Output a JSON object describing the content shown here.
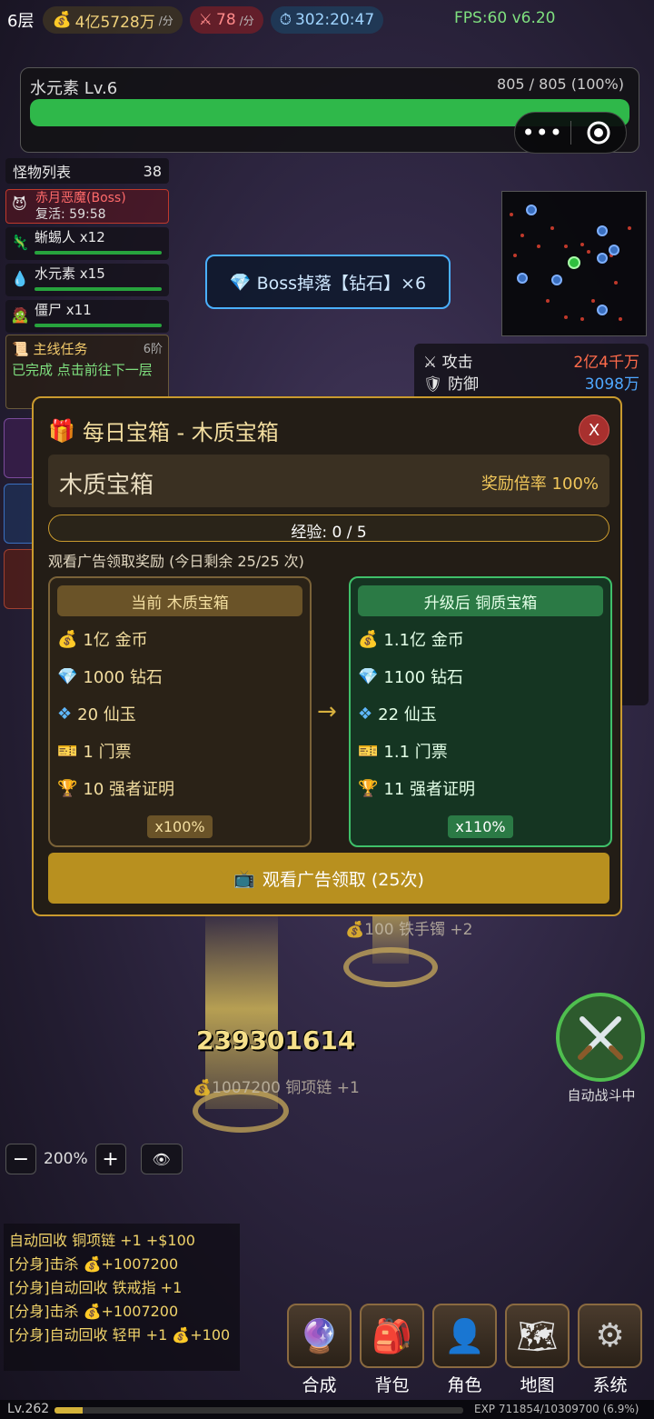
{
  "topbar": {
    "floor": "6层",
    "gold": "4亿5728万",
    "gold_unit": "/分",
    "attack": "78",
    "attack_unit": "/分",
    "time": "302:20:47",
    "fps": "FPS:60 v6.20"
  },
  "boss_hp": {
    "name": "水元素 Lv.6",
    "value": "805 / 805",
    "percent_text": "(100%)",
    "fraction": 1.0
  },
  "monster_list": {
    "title": "怪物列表",
    "count": "38",
    "boss": {
      "name": "赤月恶魔(Boss)",
      "respawn": "复活: 59:58"
    },
    "items": [
      {
        "label": "蜥蜴人 x12"
      },
      {
        "label": "水元素 x15"
      },
      {
        "label": "僵尸 x11"
      }
    ]
  },
  "quest": {
    "title": "主线任务",
    "tier": "6阶",
    "text": "已完成 点击前往下一层"
  },
  "drop_banner": {
    "text": "Boss掉落【钻石】×6"
  },
  "stats": [
    {
      "label": "攻击",
      "value": "2亿4千万",
      "color": "#ff6b4a"
    },
    {
      "label": "防御",
      "value": "3098万",
      "color": "#4fa8ff"
    }
  ],
  "modal": {
    "title": "每日宝箱 - 木质宝箱",
    "close_label": "X",
    "chest_name": "木质宝箱",
    "reward_rate": "奖励倍率 100%",
    "exp_text": "经验: 0 / 5",
    "exp_fraction": 0.0,
    "hint": "观看广告领取奖励 (今日剩余 25/25 次)",
    "arrow": "→",
    "current": {
      "header": "当前 木质宝箱",
      "rewards": [
        {
          "icon": "money-bag-icon",
          "text": "1亿 金币"
        },
        {
          "icon": "diamond-icon",
          "text": "1000 钻石"
        },
        {
          "icon": "jade-icon",
          "text": "20 仙玉"
        },
        {
          "icon": "ticket-icon",
          "text": "1 门票"
        },
        {
          "icon": "trophy-icon",
          "text": "10 强者证明"
        }
      ],
      "multiplier": "x100%"
    },
    "upgrade": {
      "header": "升级后 铜质宝箱",
      "rewards": [
        {
          "icon": "money-bag-icon",
          "text": "1.1亿 金币"
        },
        {
          "icon": "diamond-icon",
          "text": "1100 钻石"
        },
        {
          "icon": "jade-icon",
          "text": "22 仙玉"
        },
        {
          "icon": "ticket-icon",
          "text": "1.1 门票"
        },
        {
          "icon": "trophy-icon",
          "text": "11 强者证明"
        }
      ],
      "multiplier": "x110%"
    },
    "watch_button": "观看广告领取 (25次)"
  },
  "battlefield": {
    "damage_number": "239301614",
    "drop1": "1007200",
    "drop1_item": "铜项链 +1",
    "drop2": "100",
    "drop2_item": "铁手镯 +2"
  },
  "auto_fight": {
    "label": "自动战斗中"
  },
  "zoom": {
    "minus": "−",
    "value": "200%",
    "plus": "+"
  },
  "log": [
    "自动回收 铜项链 +1 +$100",
    "[分身]击杀 💰+1007200",
    "[分身]自动回收 铁戒指 +1",
    "[分身]击杀 💰+1007200",
    "[分身]自动回收 轻甲 +1 💰+100"
  ],
  "dock": [
    {
      "label": "合成",
      "icon": "crystal-ball-icon"
    },
    {
      "label": "背包",
      "icon": "backpack-icon"
    },
    {
      "label": "角色",
      "icon": "character-icon"
    },
    {
      "label": "地图",
      "icon": "map-icon"
    },
    {
      "label": "系统",
      "icon": "gear-icon"
    }
  ],
  "bottom": {
    "level": "Lv.262",
    "exp_text": "EXP 711854/10309700 (6.9%)",
    "exp_fraction": 0.069
  }
}
